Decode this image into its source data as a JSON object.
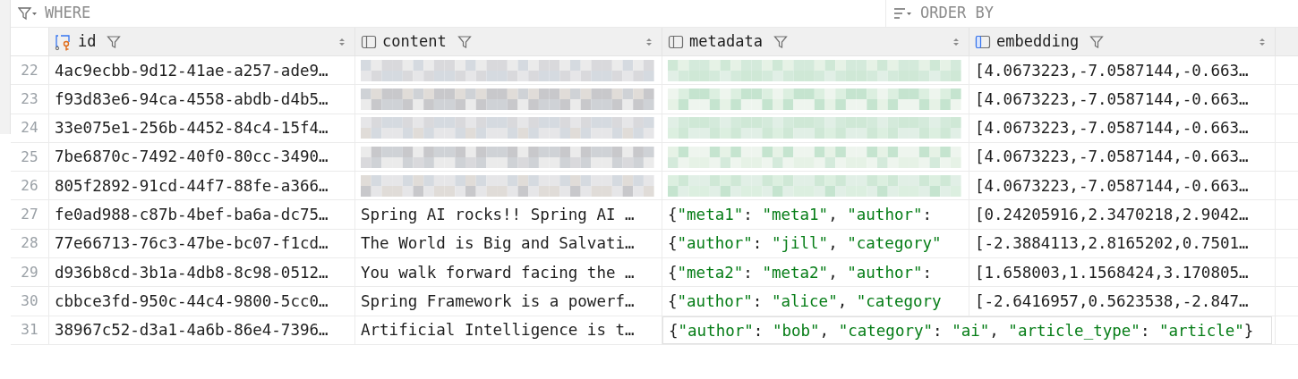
{
  "filter_bar": {
    "where_placeholder": "WHERE",
    "order_placeholder": "ORDER BY"
  },
  "columns": [
    {
      "name": "id",
      "kind": "key"
    },
    {
      "name": "content",
      "kind": "column"
    },
    {
      "name": "metadata",
      "kind": "column"
    },
    {
      "name": "embedding",
      "kind": "vector"
    }
  ],
  "rows": [
    {
      "number": "22",
      "cells": [
        {
          "kind": "text",
          "text": "4ac9ecbb-9d12-41ae-a257-ade9…",
          "expanded": false
        },
        {
          "kind": "redacted"
        },
        {
          "kind": "redacted"
        },
        {
          "kind": "text",
          "text": "[4.0673223,-7.0587144,-0.663…",
          "expanded": false
        }
      ]
    },
    {
      "number": "23",
      "cells": [
        {
          "kind": "text",
          "text": "f93d83e6-94ca-4558-abdb-d4b5…",
          "expanded": false
        },
        {
          "kind": "redacted"
        },
        {
          "kind": "redacted"
        },
        {
          "kind": "text",
          "text": "[4.0673223,-7.0587144,-0.663…",
          "expanded": false
        }
      ]
    },
    {
      "number": "24",
      "cells": [
        {
          "kind": "text",
          "text": "33e075e1-256b-4452-84c4-15f4…",
          "expanded": false
        },
        {
          "kind": "redacted"
        },
        {
          "kind": "redacted"
        },
        {
          "kind": "text",
          "text": "[4.0673223,-7.0587144,-0.663…",
          "expanded": false
        }
      ]
    },
    {
      "number": "25",
      "cells": [
        {
          "kind": "text",
          "text": "7be6870c-7492-40f0-80cc-3490…",
          "expanded": false
        },
        {
          "kind": "redacted"
        },
        {
          "kind": "redacted"
        },
        {
          "kind": "text",
          "text": "[4.0673223,-7.0587144,-0.663…",
          "expanded": false
        }
      ]
    },
    {
      "number": "26",
      "cells": [
        {
          "kind": "text",
          "text": "805f2892-91cd-44f7-88fe-a366…",
          "expanded": false
        },
        {
          "kind": "redacted"
        },
        {
          "kind": "redacted"
        },
        {
          "kind": "text",
          "text": "[4.0673223,-7.0587144,-0.663…",
          "expanded": false
        }
      ]
    },
    {
      "number": "27",
      "cells": [
        {
          "kind": "text",
          "text": "fe0ad988-c87b-4bef-ba6a-dc75…",
          "expanded": false
        },
        {
          "kind": "text",
          "text": "Spring AI rocks!! Spring AI …",
          "expanded": false
        },
        {
          "kind": "json",
          "text": "{\"meta1\": \"meta1\", \"author\":",
          "expanded": false
        },
        {
          "kind": "text",
          "text": "[0.24205916,2.3470218,2.9042…",
          "expanded": false
        }
      ]
    },
    {
      "number": "28",
      "cells": [
        {
          "kind": "text",
          "text": "77e66713-76c3-47be-bc07-f1cd…",
          "expanded": false
        },
        {
          "kind": "text",
          "text": "The World is Big and Salvati…",
          "expanded": false
        },
        {
          "kind": "json",
          "text": "{\"author\": \"jill\", \"category\"",
          "expanded": false
        },
        {
          "kind": "text",
          "text": "[-2.3884113,2.8165202,0.7501…",
          "expanded": false
        }
      ]
    },
    {
      "number": "29",
      "cells": [
        {
          "kind": "text",
          "text": "d936b8cd-3b1a-4db8-8c98-0512…",
          "expanded": false
        },
        {
          "kind": "text",
          "text": "You walk forward facing the …",
          "expanded": false
        },
        {
          "kind": "json",
          "text": "{\"meta2\": \"meta2\", \"author\":",
          "expanded": false
        },
        {
          "kind": "text",
          "text": "[1.658003,1.1568424,3.170805…",
          "expanded": false
        }
      ]
    },
    {
      "number": "30",
      "cells": [
        {
          "kind": "text",
          "text": "cbbce3fd-950c-44c4-9800-5cc0…",
          "expanded": false
        },
        {
          "kind": "text",
          "text": "Spring Framework is a powerf…",
          "expanded": false
        },
        {
          "kind": "json",
          "text": "{\"author\": \"alice\", \"category",
          "expanded": false
        },
        {
          "kind": "text",
          "text": "[-2.6416957,0.5623538,-2.847…",
          "expanded": false
        }
      ]
    },
    {
      "number": "31",
      "cells": [
        {
          "kind": "text",
          "text": "38967c52-d3a1-4a6b-86e4-7396…",
          "expanded": false
        },
        {
          "kind": "text",
          "text": "Artificial Intelligence is t…",
          "expanded": false
        },
        {
          "kind": "json",
          "text": "{\"author\": \"bob\", \"category\": \"ai\", \"article_type\": \"article\"}",
          "expanded": true
        }
      ]
    }
  ]
}
